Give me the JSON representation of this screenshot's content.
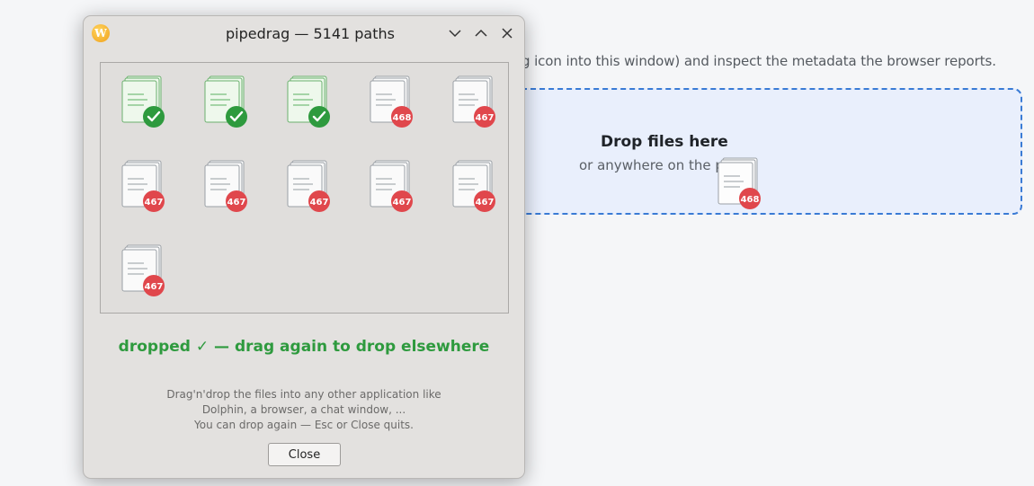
{
  "background_page": {
    "instructions": "g icon into this window) and inspect the metadata the browser reports.",
    "dropzone": {
      "title": "Drop files here",
      "subtitle": "or anywhere on the pa"
    },
    "drag_ghost": {
      "count": "468"
    }
  },
  "window": {
    "title": "pipedrag — 5141 paths",
    "app_icon_letter": "W",
    "tiles": [
      {
        "state": "done",
        "badge": ""
      },
      {
        "state": "done",
        "badge": ""
      },
      {
        "state": "done",
        "badge": ""
      },
      {
        "state": "pending",
        "badge": "468"
      },
      {
        "state": "pending",
        "badge": "467"
      },
      {
        "state": "pending",
        "badge": "467"
      },
      {
        "state": "pending",
        "badge": "467"
      },
      {
        "state": "pending",
        "badge": "467"
      },
      {
        "state": "pending",
        "badge": "467"
      },
      {
        "state": "pending",
        "badge": "467"
      },
      {
        "state": "pending",
        "badge": "467"
      }
    ],
    "status": "dropped ✓ — drag again to drop elsewhere",
    "hint_lines": [
      "Drag'n'drop the files into any other application like",
      "Dolphin, a browser, a chat window, ...",
      "You can drop again — Esc or Close quits."
    ],
    "close_label": "Close"
  },
  "colors": {
    "done_green": "#2e9a3e",
    "badge_red": "#e0474c",
    "accent_blue": "#3a7bd5"
  }
}
